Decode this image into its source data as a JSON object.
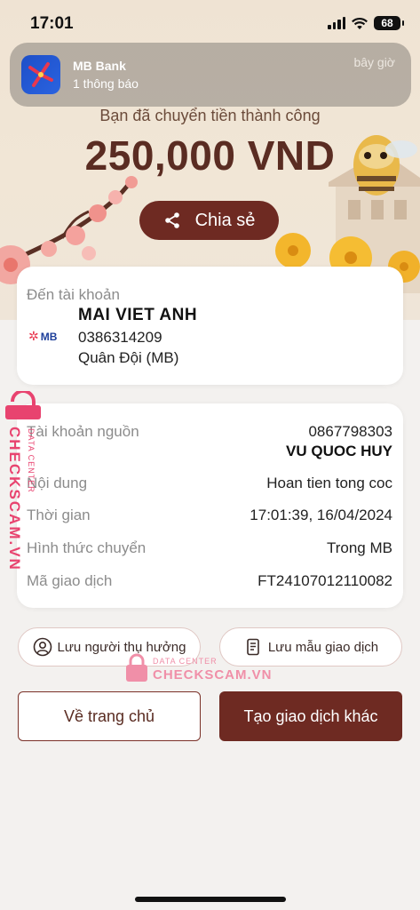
{
  "status_bar": {
    "time": "17:01",
    "battery": "68"
  },
  "notification": {
    "app_name": "MB Bank",
    "message": "1 thông báo",
    "time": "bây giờ"
  },
  "result": {
    "title": "Bạn đã chuyển tiền thành công",
    "amount": "250,000 VND",
    "share_label": "Chia sẻ"
  },
  "recipient": {
    "label": "Đến tài khoản",
    "bank_logo_text": "MB",
    "name": "MAI VIET ANH",
    "account": "0386314209",
    "bank": "Quân Đội (MB)"
  },
  "details": {
    "source_label": "Tài khoản nguồn",
    "source_account": "0867798303",
    "source_name": "VU QUOC HUY",
    "content_label": "Nội dung",
    "content_value": "Hoan tien tong coc",
    "time_label": "Thời gian",
    "time_value": "17:01:39, 16/04/2024",
    "method_label": "Hình thức chuyển",
    "method_value": "Trong MB",
    "code_label": "Mã giao dịch",
    "code_value": "FT24107012110082"
  },
  "actions": {
    "save_beneficiary": "Lưu người thụ hưởng",
    "save_template": "Lưu mẫu giao dịch",
    "home": "Về trang chủ",
    "new_transaction": "Tạo giao dịch khác"
  },
  "watermark": {
    "vertical_brand": "CHECKSCAM.VN",
    "vertical_sub": "DATA CENTER",
    "center_sub": "DATA CENTER",
    "center_brand": "CHECKSCAM.VN"
  },
  "colors": {
    "brand": "#6e2a22",
    "watermark": "#e8436f"
  }
}
